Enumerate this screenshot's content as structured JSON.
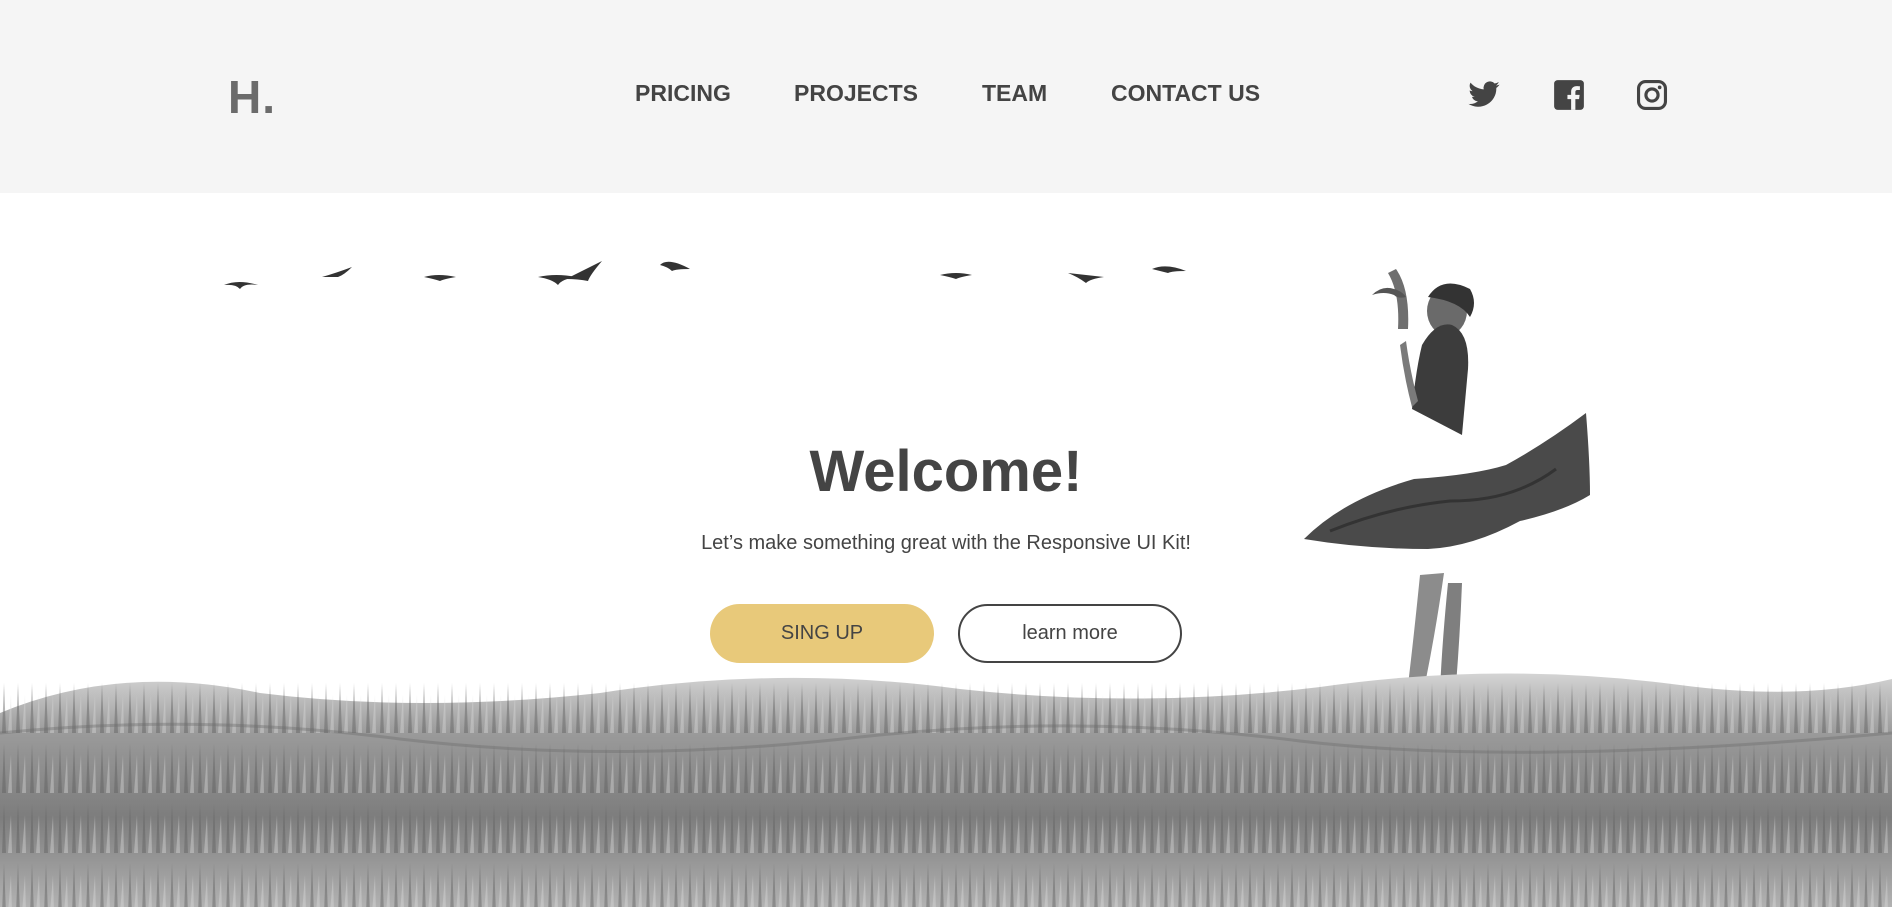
{
  "header": {
    "logo": "H.",
    "nav": [
      {
        "label": "PRICING"
      },
      {
        "label": "PROJECTS"
      },
      {
        "label": "TEAM"
      },
      {
        "label": "CONTACT US"
      }
    ],
    "social": [
      "twitter-icon",
      "facebook-icon",
      "instagram-icon"
    ]
  },
  "hero": {
    "title": "Welcome!",
    "subtitle": "Let’s make something great with the Responsive UI Kit!",
    "primary_button": "SING UP",
    "secondary_button": "learn more"
  },
  "colors": {
    "header_bg": "#f5f5f5",
    "text": "#444444",
    "accent": "#e8c97a"
  }
}
